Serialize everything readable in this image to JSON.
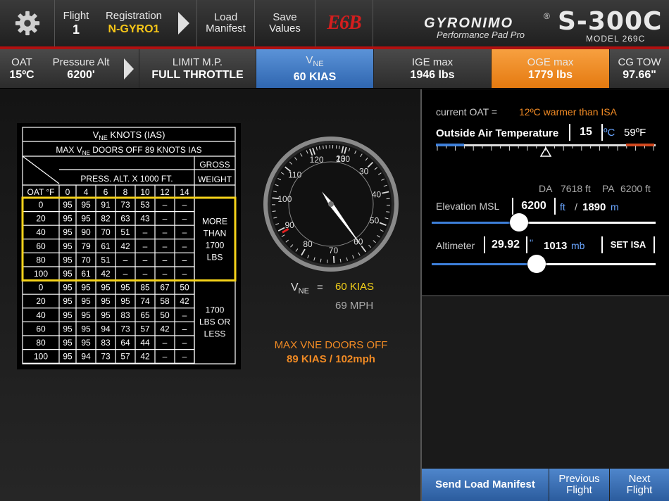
{
  "toolbar": {
    "flight_label": "Flight",
    "flight_value": "1",
    "registration_label": "Registration",
    "registration_value": "N-GYRO1",
    "load_manifest_line1": "Load",
    "load_manifest_line2": "Manifest",
    "save_values_line1": "Save",
    "save_values_line2": "Values",
    "e6b_label": "E6B",
    "brand_name": "GYRONIMO",
    "brand_tagline": "Performance Pad Pro",
    "model_name": "S-300C",
    "model_sub": "MODEL 269C",
    "registered_mark": "®"
  },
  "statusbar": {
    "oat_label": "OAT",
    "oat_value": "15ºC",
    "pa_label": "Pressure Alt",
    "pa_value": "6200'",
    "limit_label": "LIMIT M.P.",
    "limit_value": "FULL THROTTLE",
    "vne_label_main": "V",
    "vne_label_sub": "NE",
    "vne_value": "60 KIAS",
    "ige_label": "IGE max",
    "ige_value": "1946 lbs",
    "oge_label": "OGE max",
    "oge_value": "1779 lbs",
    "cg_label": "CG TOW",
    "cg_value": "97.66\""
  },
  "vne_table": {
    "title_main": "V",
    "title_sub": "NE",
    "title_rest": " KNOTS (IAS)",
    "subtitle": "MAX V",
    "subtitle_sub": "NE",
    "subtitle_rest": " DOORS OFF 89 KNOTS IAS",
    "press_alt_header": "PRESS. ALT. X 1000 FT.",
    "gross_header_1": "GROSS",
    "gross_header_2": "WEIGHT",
    "oat_header": "OAT °F",
    "alt_columns": [
      "0",
      "4",
      "6",
      "8",
      "10",
      "12",
      "14"
    ],
    "group_1_label": [
      "MORE",
      "THAN",
      "1700",
      "LBS"
    ],
    "group_2_label": [
      "1700",
      "LBS OR",
      "LESS"
    ],
    "rows_heavy": [
      [
        "0",
        "95",
        "95",
        "91",
        "73",
        "53",
        "–",
        "–"
      ],
      [
        "20",
        "95",
        "95",
        "82",
        "63",
        "43",
        "–",
        "–"
      ],
      [
        "40",
        "95",
        "90",
        "70",
        "51",
        "–",
        "–",
        "–"
      ],
      [
        "60",
        "95",
        "79",
        "61",
        "42",
        "–",
        "–",
        "–"
      ],
      [
        "80",
        "95",
        "70",
        "51",
        "–",
        "–",
        "–",
        "–"
      ],
      [
        "100",
        "95",
        "61",
        "42",
        "–",
        "–",
        "–",
        "–"
      ]
    ],
    "rows_light": [
      [
        "0",
        "95",
        "95",
        "95",
        "95",
        "85",
        "67",
        "50"
      ],
      [
        "20",
        "95",
        "95",
        "95",
        "95",
        "74",
        "58",
        "42"
      ],
      [
        "40",
        "95",
        "95",
        "95",
        "83",
        "65",
        "50",
        "–"
      ],
      [
        "60",
        "95",
        "95",
        "94",
        "73",
        "57",
        "42",
        "–"
      ],
      [
        "80",
        "95",
        "95",
        "83",
        "64",
        "44",
        "–",
        "–"
      ],
      [
        "100",
        "95",
        "94",
        "73",
        "57",
        "42",
        "–",
        "–"
      ]
    ]
  },
  "gauge": {
    "needle_value_kias": 60,
    "scale_labels": [
      "130",
      "20",
      "30",
      "40",
      "50",
      "60",
      "70",
      "80",
      "90",
      "100",
      "110",
      "120"
    ],
    "red_mark_kias": 89
  },
  "vne_readout": {
    "label_main": "V",
    "label_sub": "NE",
    "equals": "=",
    "kias": "60 KIAS",
    "mph": "69 MPH",
    "doors_off_label": "MAX VNE DOORS OFF",
    "doors_off_value": "89 KIAS / 102mph"
  },
  "oat_panel": {
    "current_oat_label": "current OAT =",
    "current_oat_value": "12ºC warmer than ISA",
    "title": "Outside Air Temperature",
    "temp_c_value": "15",
    "temp_c_unit": "ºC",
    "temp_f": "59ºF",
    "slider_fraction": 0.5
  },
  "altitude_panel": {
    "da_label": "DA",
    "da_value": "7618 ft",
    "pa_label": "PA",
    "pa_value": "6200 ft",
    "elevation_label": "Elevation MSL",
    "elevation_ft_value": "6200",
    "elevation_ft_unit": "ft",
    "slash": "/",
    "elevation_m_value": "1890",
    "elevation_m_unit": "m",
    "elevation_slider_fraction": 0.39,
    "altimeter_label": "Altimeter",
    "altimeter_inhg_value": "29.92",
    "altimeter_inhg_unit": "\"",
    "altimeter_mb_value": "1013",
    "altimeter_mb_unit": "mb",
    "set_isa_label": "SET ISA",
    "altimeter_slider_fraction": 0.47
  },
  "bottom": {
    "send_load_manifest": "Send Load Manifest",
    "previous_line1": "Previous",
    "previous_line2": "Flight",
    "next_line1": "Next",
    "next_line2": "Flight"
  },
  "colors": {
    "accent_orange": "#f08a24",
    "accent_yellow": "#f5d21a",
    "highlight_blue": "#3d78c4",
    "brand_red": "#b01010"
  }
}
